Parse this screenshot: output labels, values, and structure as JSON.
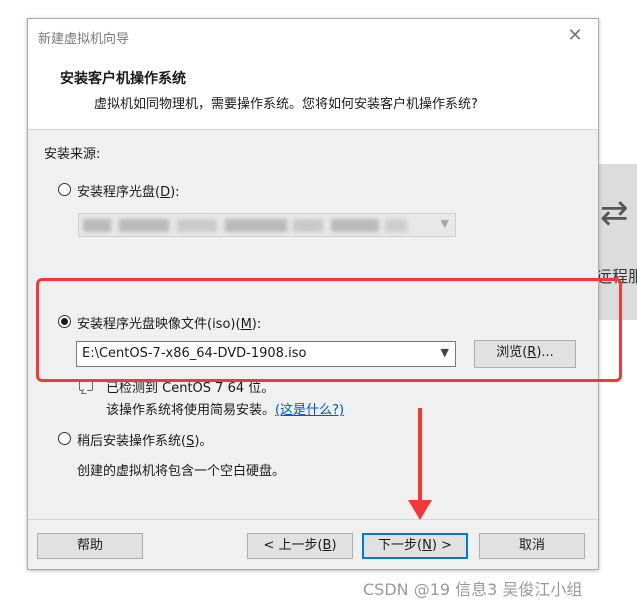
{
  "background_window": {
    "label_fragment": "远程服",
    "arrow_icon": "transfer-arrows-icon"
  },
  "dialog": {
    "title": "新建虚拟机向导",
    "header": {
      "title": "安装客户机操作系统",
      "subtitle": "虚拟机如同物理机，需要操作系统。您将如何安装客户机操作系统?"
    },
    "install_source_label": "安装来源:",
    "option_disc": {
      "label_prefix": "安装程序光盘(",
      "accel": "D",
      "label_suffix": "):",
      "selected": false,
      "combo_value_blurred": true
    },
    "option_iso": {
      "label_prefix": "安装程序光盘映像文件(iso)(",
      "accel": "M",
      "label_suffix": "):",
      "selected": true,
      "combo_value": "E:\\CentOS-7-x86_64-DVD-1908.iso",
      "browse_prefix": "浏览(",
      "browse_accel": "R",
      "browse_suffix": ")..."
    },
    "detection": {
      "line1": "已检测到 CentOS 7 64 位。",
      "line2": "该操作系统将使用简易安装。",
      "link": "(这是什么?)"
    },
    "option_later": {
      "label_prefix": "稍后安装操作系统(",
      "accel": "S",
      "label_suffix": ")。",
      "selected": false,
      "description": "创建的虚拟机将包含一个空白硬盘。"
    },
    "buttons": {
      "help": "帮助",
      "back_prefix": "< 上一步(",
      "back_accel": "B",
      "back_suffix": ")",
      "next_prefix": "下一步(",
      "next_accel": "N",
      "next_suffix": ") >",
      "cancel": "取消"
    }
  },
  "watermark": "CSDN @19 信息3 吴俊江小组",
  "annotation_color": "#f03a3a"
}
